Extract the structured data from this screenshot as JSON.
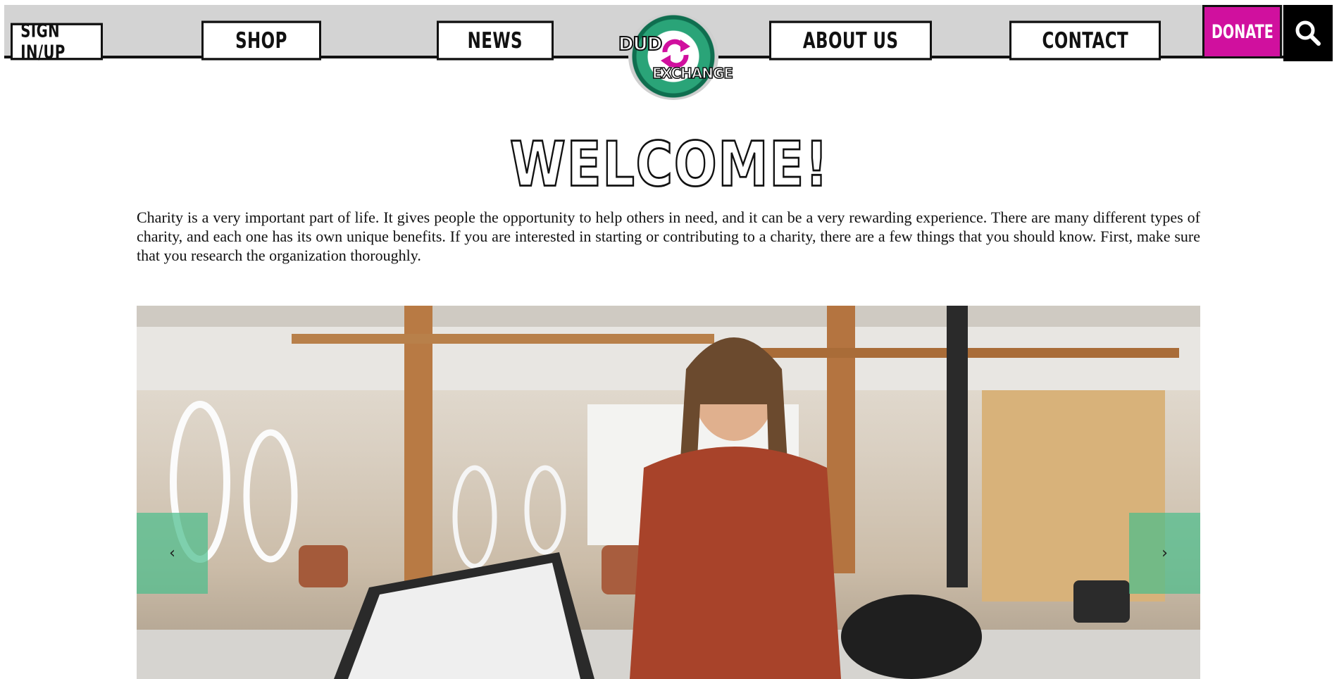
{
  "nav": {
    "signin_label": "SIGN IN/UP",
    "shop_label": "SHOP",
    "news_label": "NEWS",
    "about_label": "ABOUT US",
    "contact_label": "CONTACT",
    "donate_label": "DONATE",
    "search_icon": "search-icon"
  },
  "logo": {
    "line1": "DUD",
    "line2": "EXCHANGE",
    "colors": {
      "ring": "#2aa478",
      "arrows": "#d0109e"
    }
  },
  "main": {
    "title": "WELCOME!",
    "intro": "Charity is a very important part of life. It gives people the opportunity to help others in need, and it can be a very rewarding experience. There are many different types of charity, and each one has its own unique benefits. If you are interested in starting or contributing to a charity, there are a few things that you should know. First, make sure that you research the organization thoroughly."
  },
  "carousel": {
    "prev_label": "‹",
    "next_label": "›"
  },
  "colors": {
    "topbar": "#d3d3d3",
    "donate": "#d0109e",
    "carousel_arrow": "#48be8c"
  }
}
